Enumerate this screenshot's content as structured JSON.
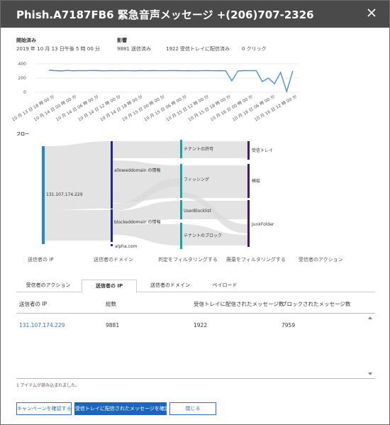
{
  "dialog": {
    "title": "Phish.A7187FB6 緊急音声メッセージ +(206)707-2326",
    "close_icon": "close-icon"
  },
  "summary": {
    "start_label": "開始済み",
    "start_value": "2019 年 10 月 13 日午後 5 時 00 分",
    "impact_label": "影響",
    "sent_value": "9881 送信済み",
    "delivered_value": "1922 受信トレイに配信済み",
    "clicks_value": "0 クリック"
  },
  "chart_data": {
    "type": "line",
    "title": "",
    "xlabel": "",
    "ylabel": "",
    "ylim": [
      0,
      400
    ],
    "y_ticks": [
      "400",
      "200",
      "0"
    ],
    "x_tick_labels": [
      "10 月 13 日 18 時 00 分",
      "10 月 14 日 00 時 00 分",
      "10 月 14 日 06 時 00 分",
      "10 月 14 日 12 時 00 分",
      "10 月 14 日 18 時 00 分",
      "10 月 15 日 00 時 00 分",
      "10 月 15 日 06 時 00 分",
      "10 月 15 日 12 時 00 分",
      "10 月 15 日 18 時 00 分",
      "10 月 16 日 00 時 00 分",
      "10 月 16 日 06 時 00 分",
      "10 月 16 日 12 時 00 分"
    ],
    "grid": true,
    "color": "#4a90e2",
    "series": [
      {
        "values": [
          310,
          305,
          300,
          308,
          302,
          306,
          303,
          307,
          305,
          302,
          306,
          303,
          305,
          304,
          302,
          306,
          303,
          305,
          304,
          303,
          306,
          305,
          303,
          305,
          302,
          304,
          306,
          303,
          305,
          302,
          160,
          300,
          305,
          304,
          306,
          150,
          200,
          120,
          280,
          10,
          300
        ]
      }
    ]
  },
  "flow": {
    "label": "フロー",
    "nodes": {
      "ip": "131.107.174.229",
      "allowed": "alloweddomain の情報",
      "blocked": "blockeddomain の情報",
      "alpha": "alpha.com",
      "tenant_allow": "テナントの許可",
      "phishing": "フィッシング",
      "userblock": "UserBlocklist",
      "tenant_block": "テナントのブロック",
      "inbox": "受信トレイ",
      "quarantine": "検疫",
      "junk": "JunkFolder"
    },
    "columns": [
      "送信者の IP",
      "送信者のドメイン",
      "判定をフィルタリングする",
      "廃棄をフィルタリングする",
      "受信者のアクション"
    ],
    "colors": {
      "ip": "#1e88d4",
      "domain": "#1c2a8a",
      "verdict": "#1aa3a3",
      "dispose": "#4a1a5e"
    }
  },
  "tabs": {
    "items": [
      "受信者のアクション",
      "送信者の IP",
      "送信者のドメイン",
      "ペイロード"
    ],
    "active_index": 1
  },
  "grid": {
    "headers": [
      "送信者の IP",
      "総数",
      "受信トレイに配信されたメッセージ数",
      "ブロックされたメッセージ数"
    ],
    "rows": [
      [
        "131.107.174.229",
        "9881",
        "1922",
        "7959"
      ]
    ]
  },
  "status": "1 アイテムが読み込まれました。",
  "buttons": {
    "confirm_campaign": "キャンペーンを確認する",
    "confirm_inbox": "受信トレイに配信されたメッセージを確認する",
    "close": "閉じる"
  }
}
